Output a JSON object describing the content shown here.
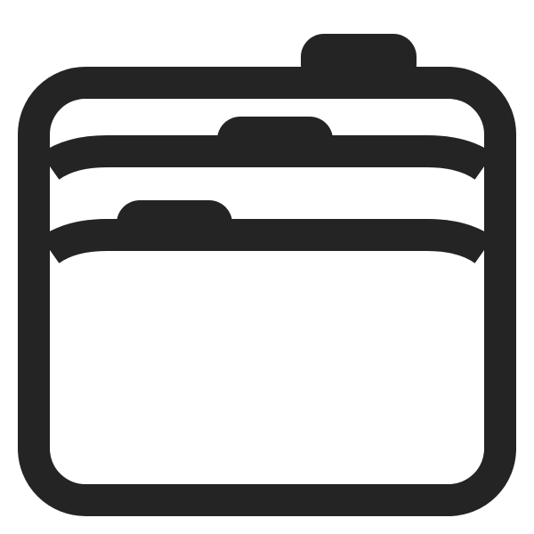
{
  "icon": {
    "name": "stacked-folders-icon",
    "stroke_color": "#242424",
    "fill_color": "#ffffff"
  }
}
